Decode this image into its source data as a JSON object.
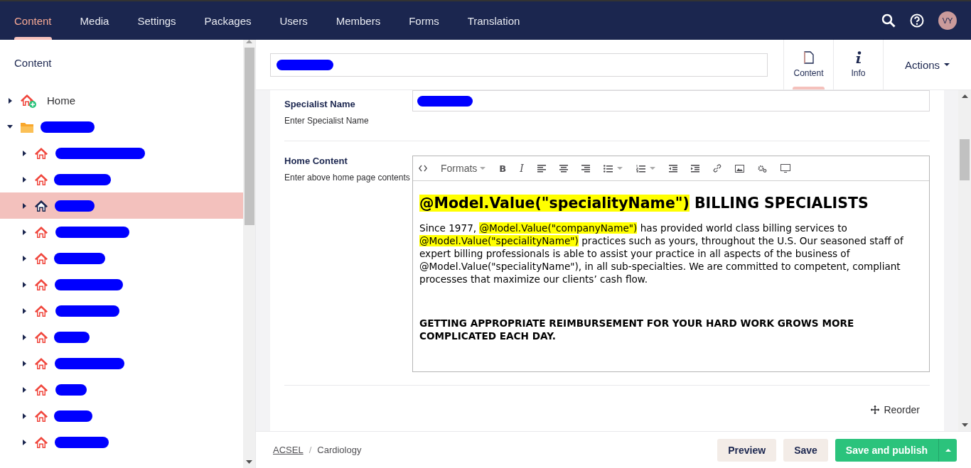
{
  "nav": {
    "sections": [
      {
        "label": "Content",
        "selected": true
      },
      {
        "label": "Media",
        "selected": false
      },
      {
        "label": "Settings",
        "selected": false
      },
      {
        "label": "Packages",
        "selected": false
      },
      {
        "label": "Users",
        "selected": false
      },
      {
        "label": "Members",
        "selected": false
      },
      {
        "label": "Forms",
        "selected": false
      },
      {
        "label": "Translation",
        "selected": false
      }
    ],
    "avatar": "VY"
  },
  "tree": {
    "title": "Content",
    "items": [
      {
        "kind": "home-add",
        "label": "Home",
        "expanded": false,
        "selected": false
      },
      {
        "kind": "folder",
        "expanded": true,
        "selected": false,
        "children": [
          {
            "kind": "home",
            "expanded": false,
            "selected": false
          },
          {
            "kind": "home",
            "expanded": false,
            "selected": false
          },
          {
            "kind": "home",
            "expanded": false,
            "selected": true
          },
          {
            "kind": "home",
            "expanded": false,
            "selected": false
          },
          {
            "kind": "home",
            "expanded": false,
            "selected": false
          },
          {
            "kind": "home",
            "expanded": false,
            "selected": false
          },
          {
            "kind": "home",
            "expanded": false,
            "selected": false
          },
          {
            "kind": "home",
            "expanded": false,
            "selected": false
          },
          {
            "kind": "home",
            "expanded": false,
            "selected": false
          },
          {
            "kind": "home",
            "expanded": false,
            "selected": false
          },
          {
            "kind": "home",
            "expanded": false,
            "selected": false
          },
          {
            "kind": "home",
            "expanded": false,
            "selected": false
          }
        ]
      }
    ]
  },
  "editor": {
    "apps": [
      {
        "kind": "document",
        "label": "Content",
        "selected": true
      },
      {
        "kind": "info",
        "label": "Info",
        "selected": false
      }
    ],
    "actions": "Actions",
    "properties": [
      {
        "kind": "text",
        "label": "Specialist Name",
        "description": "Enter Specialist Name"
      },
      {
        "kind": "richtext",
        "label": "Home Content",
        "description": "Enter above home page contents",
        "formats": "Formats",
        "toolbar": [
          {
            "kind": "code"
          },
          {
            "kind": "formats"
          },
          {
            "kind": "bold",
            "glyph": "B"
          },
          {
            "kind": "italic",
            "glyph": "I"
          },
          {
            "kind": "align-left"
          },
          {
            "kind": "align-center"
          },
          {
            "kind": "align-right"
          },
          {
            "kind": "bullet-list"
          },
          {
            "kind": "numbered-list"
          },
          {
            "kind": "outdent"
          },
          {
            "kind": "indent"
          },
          {
            "kind": "link"
          },
          {
            "kind": "image"
          },
          {
            "kind": "macro"
          },
          {
            "kind": "embed"
          }
        ],
        "heading": [
          {
            "text": "@Model.Value(\"specialityName\")",
            "highlight": true
          },
          {
            "text": " BILLING SPECIALISTS",
            "highlight": false
          }
        ],
        "paragraph": [
          {
            "text": "Since 1977, ",
            "highlight": false
          },
          {
            "text": "@Model.Value(\"companyName\")",
            "highlight": true
          },
          {
            "text": " has provided world class billing services to ",
            "highlight": false
          },
          {
            "text": "@Model.Value(\"specialityName\")",
            "highlight": true
          },
          {
            "text": " practices such as yours, throughout the U.S. Our seasoned staff of expert billing professionals is able to assist your practice in all aspects of the business of @Model.Value(\"specialityName\"), in all sub-specialties. We are committed to competent, compliant processes that maximize our clients’ cash flow.",
            "highlight": false
          }
        ],
        "subheading": "GETTING APPROPRIATE REIMBURSEMENT FOR YOUR HARD WORK GROWS MORE COMPLICATED EACH DAY."
      }
    ],
    "reorder": "Reorder"
  },
  "footer": {
    "breadcrumb": [
      {
        "label": "ACSEL",
        "link": true
      },
      {
        "label": "Cardiology",
        "link": false
      }
    ],
    "separator": "/",
    "buttons": [
      {
        "kind": "plain",
        "label": "Preview"
      },
      {
        "kind": "plain",
        "label": "Save"
      },
      {
        "kind": "primary",
        "label": "Save and publish"
      }
    ]
  }
}
